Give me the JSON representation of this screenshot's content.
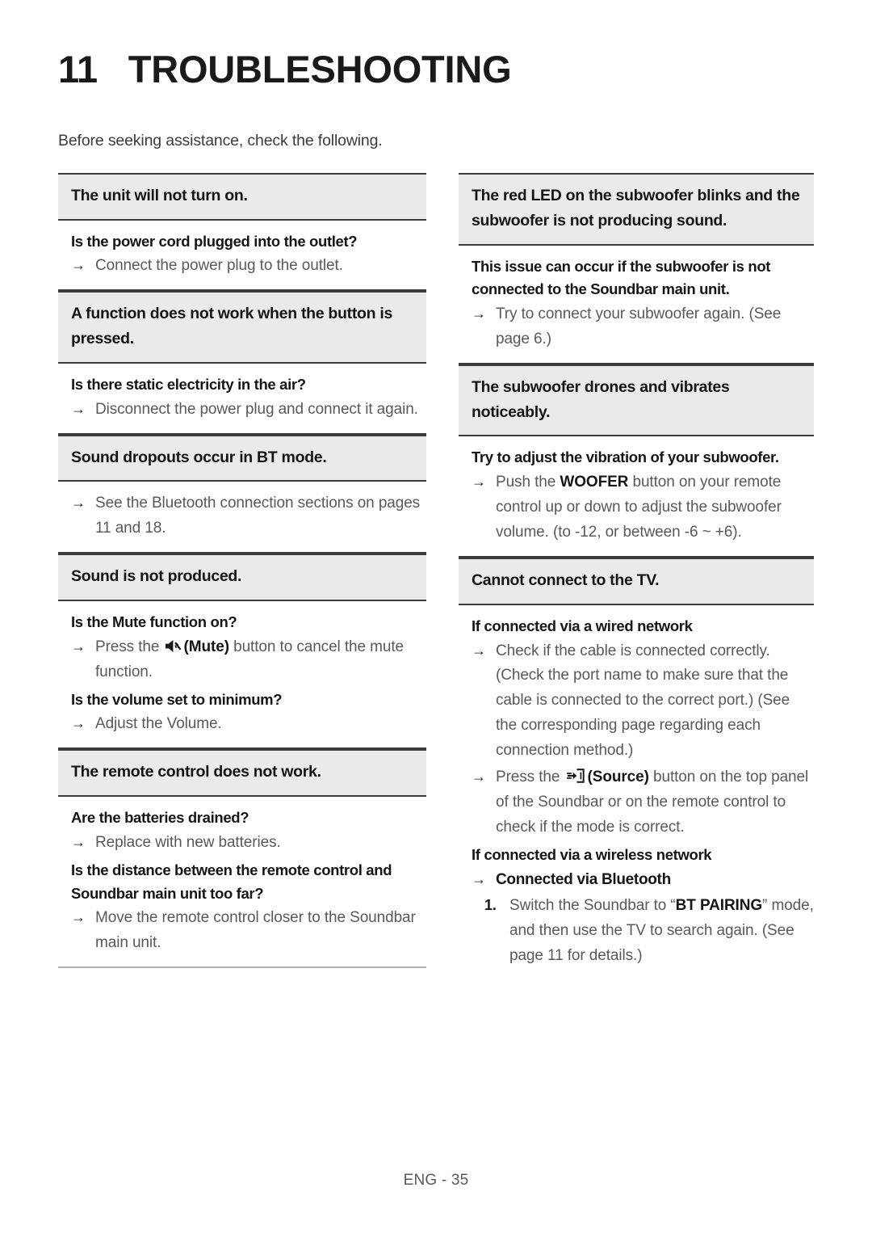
{
  "chapter": {
    "number": "11",
    "title": "TROUBLESHOOTING"
  },
  "intro": "Before seeking assistance, check the following.",
  "arrow_glyph": "→",
  "icons": {
    "mute": "mute-speaker-icon",
    "source": "source-input-icon"
  },
  "left_column": {
    "sections": [
      {
        "heading": "The unit will not turn on.",
        "question": "Is the power cord plugged into the outlet?",
        "answer": "Connect the power plug to the outlet."
      },
      {
        "heading": "A function does not work when the button is pressed.",
        "question": "Is there static electricity in the air?",
        "answer": "Disconnect the power plug and connect it again."
      },
      {
        "heading": "Sound dropouts occur in BT mode.",
        "answer": "See the Bluetooth connection sections on pages 11 and 18."
      },
      {
        "heading": "Sound is not produced.",
        "question1": "Is the Mute function on?",
        "answer1_pre": "Press the ",
        "answer1_bold": "(Mute)",
        "answer1_post": " button to cancel the mute function.",
        "question2": "Is the volume set to minimum?",
        "answer2": "Adjust the Volume."
      },
      {
        "heading": "The remote control does not work.",
        "question1": "Are the batteries drained?",
        "answer1": "Replace with new batteries.",
        "question2": "Is the distance between the remote control and Soundbar main unit too far?",
        "answer2": "Move the remote control closer to the Soundbar main unit."
      }
    ]
  },
  "right_column": {
    "sections": [
      {
        "heading": "The red LED on the subwoofer blinks and the subwoofer is not producing sound.",
        "question": "This issue can occur if the subwoofer is not connected to the Soundbar main unit.",
        "answer": "Try to connect your subwoofer again. (See page 6.)"
      },
      {
        "heading": "The subwoofer drones and vibrates noticeably.",
        "question": "Try to adjust the vibration of your subwoofer.",
        "answer_pre": "Push the ",
        "answer_bold": "WOOFER",
        "answer_post": " button on your remote control up or down to adjust the subwoofer volume. (to -12, or between -6 ~ +6)."
      },
      {
        "heading": "Cannot connect to the TV.",
        "question1": "If connected via a wired network",
        "answer1": "Check if the cable is connected correctly. (Check the port name to make sure that the cable is connected to the correct port.) (See the corresponding page regarding each connection method.)",
        "answer2_pre": "Press the ",
        "answer2_bold": "(Source)",
        "answer2_post": " button on the top panel of the Soundbar or on the remote control to check if the mode is correct.",
        "question2": "If connected via a wireless network",
        "answer3": "Connected via Bluetooth",
        "step1_number": "1.",
        "step1_pre": "Switch the Soundbar to “",
        "step1_bold": "BT PAIRING",
        "step1_post": "” mode, and then use the TV to search again. (See page 11 for details.)"
      }
    ]
  },
  "footer": "ENG - 35"
}
